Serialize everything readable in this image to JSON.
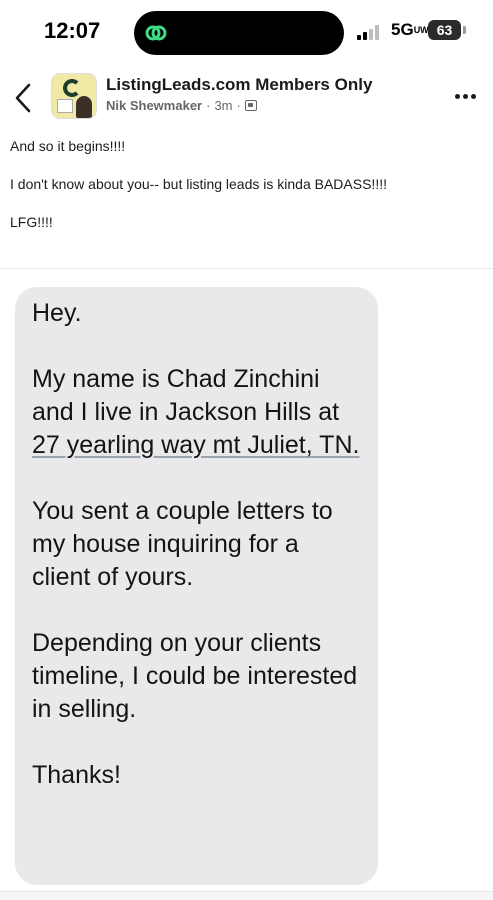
{
  "status_bar": {
    "time": "12:07",
    "network": "5G",
    "network_suffix": "UW",
    "battery": "63"
  },
  "post": {
    "group_name": "ListingLeads.com Members Only",
    "author": "Nik Shewmaker",
    "separator": "·",
    "age": "3m",
    "body": [
      "And so it begins!!!!",
      "I don't know about you-- but listing leads is kinda BADASS!!!!",
      "LFG!!!!"
    ]
  },
  "message": {
    "greeting": "Hey.",
    "intro_before_address": "My name is Chad Zinchini and I live in Jackson Hills at ",
    "address": "27 yearling way mt Juliet, TN.",
    "paragraph_2": "You sent a couple letters to my house inquiring for a client of yours.",
    "paragraph_3": "Depending on your clients timeline, I could be interested in selling.",
    "closing": "Thanks!"
  },
  "icons": {
    "island": "app-link-icon",
    "back": "chevron-left-icon",
    "more": "more-horizontal-icon",
    "audience": "group-icon"
  },
  "colors": {
    "bubble": "#e9e9eb",
    "island_icon": "#3ddc84"
  }
}
